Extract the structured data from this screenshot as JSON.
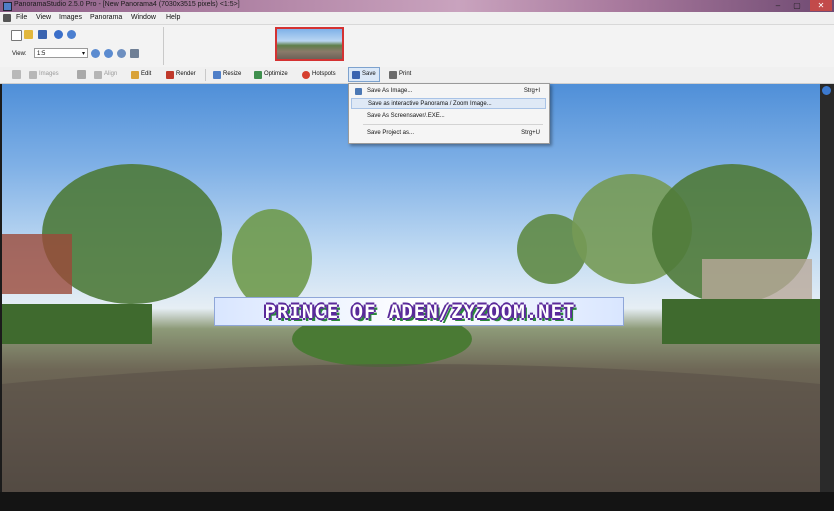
{
  "window": {
    "title": "PanoramaStudio 2.5.0 Pro - [New Panorama4 (7030x3515 pixels) <1:5>]",
    "minimize_glyph": "–",
    "maximize_glyph": "▢",
    "close_glyph": "✕"
  },
  "menubar": {
    "items": [
      {
        "label": "File"
      },
      {
        "label": "View"
      },
      {
        "label": "Images"
      },
      {
        "label": "Panorama"
      },
      {
        "label": "Window"
      },
      {
        "label": "Help"
      }
    ]
  },
  "view_control": {
    "label": "View:",
    "zoom_value": "1:5",
    "dropdown_glyph": "▾"
  },
  "toolbar": {
    "items": [
      {
        "label": "Images",
        "icon": "images-icon",
        "enabled": false
      },
      {
        "label": "Align",
        "icon": "align-icon",
        "enabled": false
      },
      {
        "label": "Edit",
        "icon": "edit-icon",
        "enabled": true
      },
      {
        "label": "Render",
        "icon": "render-icon",
        "enabled": true
      },
      {
        "label": "Resize",
        "icon": "resize-icon",
        "enabled": true
      },
      {
        "label": "Optimize",
        "icon": "optimize-icon",
        "enabled": true
      },
      {
        "label": "Hotspots",
        "icon": "hotspots-icon",
        "enabled": true
      },
      {
        "label": "Save",
        "icon": "save-icon",
        "enabled": true
      },
      {
        "label": "Print",
        "icon": "print-icon",
        "enabled": true
      }
    ]
  },
  "save_menu": {
    "items": [
      {
        "label": "Save As Image...",
        "shortcut": "Strg+I",
        "highlighted": false
      },
      {
        "label": "Save as interactive Panorama / Zoom Image...",
        "shortcut": "",
        "highlighted": true
      },
      {
        "label": "Save As Screensaver/.EXE...",
        "shortcut": "",
        "highlighted": false
      },
      {
        "label": "Save Project as...",
        "shortcut": "Strg+U",
        "highlighted": false
      }
    ]
  },
  "watermark": {
    "text": "PRINCE OF ADEN/ZYZOOM.NET"
  },
  "colors": {
    "accent": "#3c7ad0",
    "thumbnail_selection": "#d43232",
    "menu_highlight": "#dfe9f6"
  }
}
